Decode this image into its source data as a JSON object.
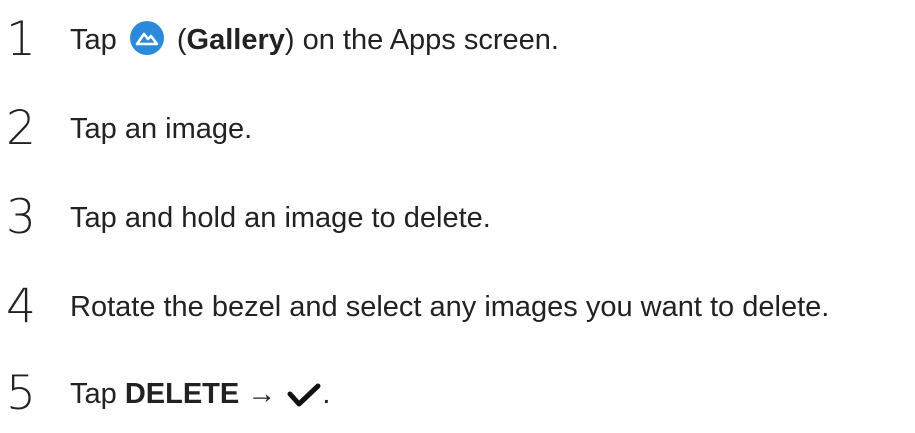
{
  "steps": [
    {
      "number": "1",
      "text_before": "Tap ",
      "icon": "gallery-icon",
      "text_mid": " (",
      "bold": "Gallery",
      "text_after": ") on the Apps screen."
    },
    {
      "number": "2",
      "text": "Tap an image."
    },
    {
      "number": "3",
      "text": "Tap and hold an image to delete."
    },
    {
      "number": "4",
      "text": "Rotate the bezel and select any images you want to delete."
    },
    {
      "number": "5",
      "text_before": "Tap ",
      "bold": "DELETE",
      "arrow": " → ",
      "icon": "checkmark-icon",
      "text_after": "."
    }
  ],
  "colors": {
    "text": "#222222",
    "gallery_icon_bg": "#2b8ad9",
    "checkmark": "#111111"
  }
}
